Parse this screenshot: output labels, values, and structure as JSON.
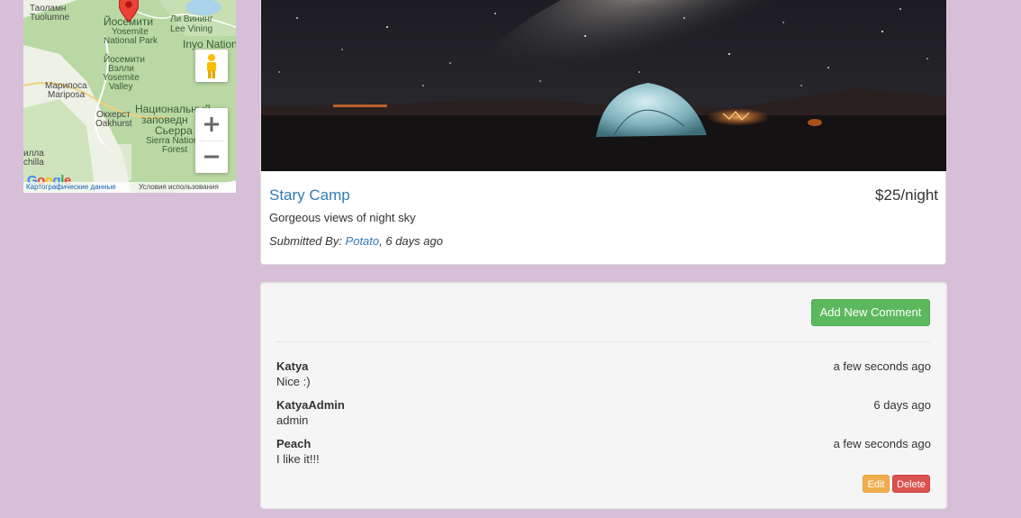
{
  "map": {
    "labels": {
      "taolamn": "Таоламн",
      "tuolumne": "Tuolumne",
      "yosemite_ru": "Йосемити",
      "yosemite_np": "Yosemite",
      "national_park": "National Park",
      "lee_vining_ru": "Ли Вининг",
      "lee_vining": "Lee Vining",
      "inyo": "Inyo Nation",
      "yosemite_valley_ru1": "Йосемити",
      "yosemite_valley_ru2": "Вэлли",
      "yosemite_valley1": "Yosemite",
      "yosemite_valley2": "Valley",
      "mariposa_ru": "Марипоса",
      "mariposa": "Mariposa",
      "oakhurst_ru": "Окхерст",
      "oakhurst": "Oakhurst",
      "sierra_ru1": "Национальный",
      "sierra_ru2": "заповедн",
      "sierra_ru3": "Сьерра",
      "sierra1": "Sierra Nation",
      "sierra2": "Forest",
      "illa": "илла",
      "chilla": "chilla"
    },
    "google": "Google",
    "attribution_data": "Картографические данные",
    "attribution_terms": "Условия использования",
    "colors": {
      "park_green": "#b9d8a3",
      "water": "#a9d3ea",
      "pin": "#ea4335"
    }
  },
  "campground": {
    "name": "Stary Camp",
    "price": "$25/night",
    "description": "Gorgeous views of night sky",
    "submitted_prefix": "Submitted By: ",
    "author": "Potato",
    "submitted_suffix": ", 6 days ago"
  },
  "comments": {
    "add_button": "Add New Comment",
    "items": [
      {
        "author": "Katya",
        "time": "a few seconds ago",
        "text": "Nice :)"
      },
      {
        "author": "KatyaAdmin",
        "time": "6 days ago",
        "text": "admin"
      },
      {
        "author": "Peach",
        "time": "a few seconds ago",
        "text": "I like it!!!"
      }
    ],
    "edit_label": "Edit",
    "delete_label": "Delete"
  }
}
